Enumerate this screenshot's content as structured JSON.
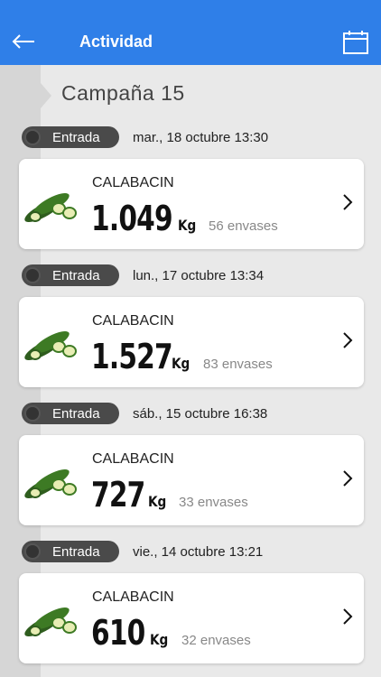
{
  "app_bar": {
    "title": "Actividad",
    "back_icon": "arrow-left-icon",
    "calendar_icon": "calendar-icon",
    "color": "#2f7fe8"
  },
  "campaign": {
    "title": "Campaña 15"
  },
  "entries": [
    {
      "type": "Entrada",
      "date": "mar., 18 octubre 13:30",
      "product": "CALABACIN",
      "weight": "1.049",
      "unit": "Kg",
      "containers": "56 envases"
    },
    {
      "type": "Entrada",
      "date": "lun., 17 octubre 13:34",
      "product": "CALABACIN",
      "weight": "1.527",
      "unit": "Kg",
      "containers": "83 envases"
    },
    {
      "type": "Entrada",
      "date": "sáb., 15 octubre 16:38",
      "product": "CALABACIN",
      "weight": "727",
      "unit": "Kg",
      "containers": "33 envases"
    },
    {
      "type": "Entrada",
      "date": "vie., 14 octubre 13:21",
      "product": "CALABACIN",
      "weight": "610",
      "unit": "Kg",
      "containers": "32 envases"
    }
  ]
}
